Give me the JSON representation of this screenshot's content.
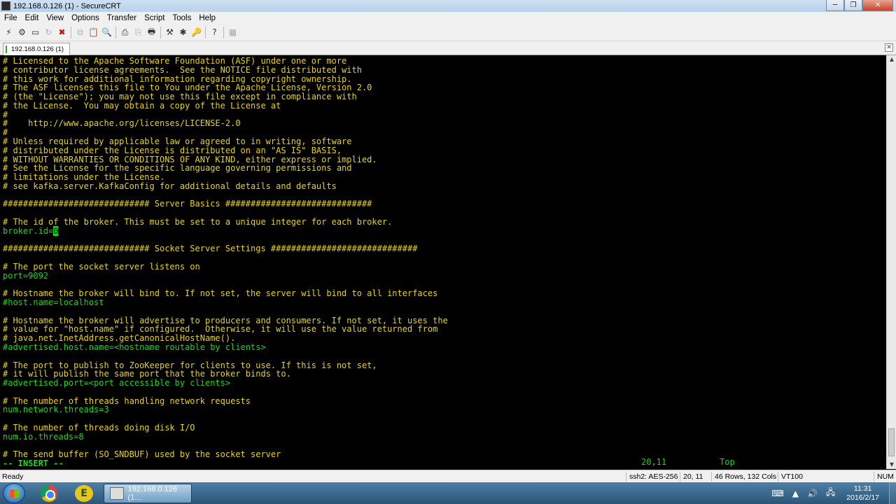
{
  "window": {
    "title": "192.168.0.126 (1) - SecureCRT"
  },
  "window_controls": {
    "minimize": "─",
    "restore": "❐",
    "close": "✕"
  },
  "menu": [
    "File",
    "Edit",
    "View",
    "Options",
    "Transfer",
    "Script",
    "Tools",
    "Help"
  ],
  "toolbar_icons": [
    "connect-icon",
    "quick-connect-icon",
    "connect-in-tab-icon",
    "reconnect-icon",
    "disconnect-icon",
    "copy-icon",
    "paste-icon",
    "find-icon",
    "print-icon",
    "print-selection-icon",
    "print-setup-icon",
    "session-options-icon",
    "global-options-icon",
    "keymap-icon",
    "help-icon",
    "sftp-icon"
  ],
  "tab": {
    "label": "192.168.0.126  (1)",
    "close": "✕"
  },
  "terminal": {
    "lines": [
      {
        "text": "# Licensed to the Apache Software Foundation (ASF) under one or more",
        "kind": "comment"
      },
      {
        "text": "# contributor license agreements.  See the NOTICE file distributed with",
        "kind": "comment"
      },
      {
        "text": "# this work for additional information regarding copyright ownership.",
        "kind": "comment"
      },
      {
        "text": "# The ASF licenses this file to You under the Apache License, Version 2.0",
        "kind": "comment"
      },
      {
        "text": "# (the \"License\"); you may not use this file except in compliance with",
        "kind": "comment"
      },
      {
        "text": "# the License.  You may obtain a copy of the License at",
        "kind": "comment"
      },
      {
        "text": "#",
        "kind": "comment"
      },
      {
        "text": "#    http://www.apache.org/licenses/LICENSE-2.0",
        "kind": "comment"
      },
      {
        "text": "#",
        "kind": "comment"
      },
      {
        "text": "# Unless required by applicable law or agreed to in writing, software",
        "kind": "comment"
      },
      {
        "text": "# distributed under the License is distributed on an \"AS IS\" BASIS,",
        "kind": "comment"
      },
      {
        "text": "# WITHOUT WARRANTIES OR CONDITIONS OF ANY KIND, either express or implied.",
        "kind": "comment"
      },
      {
        "text": "# See the License for the specific language governing permissions and",
        "kind": "comment"
      },
      {
        "text": "# limitations under the License.",
        "kind": "comment"
      },
      {
        "text": "# see kafka.server.KafkaConfig for additional details and defaults",
        "kind": "comment"
      },
      {
        "text": "",
        "kind": "blank"
      },
      {
        "text": "############################# Server Basics #############################",
        "kind": "comment"
      },
      {
        "text": "",
        "kind": "blank"
      },
      {
        "text": "# The id of the broker. This must be set to a unique integer for each broker.",
        "kind": "comment"
      },
      {
        "text": "broker.id=",
        "kind": "code",
        "cursor_char": "0"
      },
      {
        "text": "",
        "kind": "blank"
      },
      {
        "text": "############################# Socket Server Settings #############################",
        "kind": "comment"
      },
      {
        "text": "",
        "kind": "blank"
      },
      {
        "text": "# The port the socket server listens on",
        "kind": "comment"
      },
      {
        "text": "port=9092",
        "kind": "code"
      },
      {
        "text": "",
        "kind": "blank"
      },
      {
        "text": "# Hostname the broker will bind to. If not set, the server will bind to all interfaces",
        "kind": "comment"
      },
      {
        "text": "#host.name=localhost",
        "kind": "code"
      },
      {
        "text": "",
        "kind": "blank"
      },
      {
        "text": "# Hostname the broker will advertise to producers and consumers. If not set, it uses the",
        "kind": "comment"
      },
      {
        "text": "# value for \"host.name\" if configured.  Otherwise, it will use the value returned from",
        "kind": "comment"
      },
      {
        "text": "# java.net.InetAddress.getCanonicalHostName().",
        "kind": "comment"
      },
      {
        "text": "#advertised.host.name=<hostname routable by clients>",
        "kind": "code"
      },
      {
        "text": "",
        "kind": "blank"
      },
      {
        "text": "# The port to publish to ZooKeeper for clients to use. If this is not set,",
        "kind": "comment"
      },
      {
        "text": "# it will publish the same port that the broker binds to.",
        "kind": "comment"
      },
      {
        "text": "#advertised.port=<port accessible by clients>",
        "kind": "code"
      },
      {
        "text": "",
        "kind": "blank"
      },
      {
        "text": "# The number of threads handling network requests",
        "kind": "comment"
      },
      {
        "text": "num.network.threads=3",
        "kind": "code"
      },
      {
        "text": "",
        "kind": "blank"
      },
      {
        "text": "# The number of threads doing disk I/O",
        "kind": "comment"
      },
      {
        "text": "num.io.threads=8",
        "kind": "code"
      },
      {
        "text": "",
        "kind": "blank"
      },
      {
        "text": "# The send buffer (SO_SNDBUF) used by the socket server",
        "kind": "comment"
      }
    ],
    "mode_line": "-- INSERT --",
    "cursor_pos": "20,11",
    "scroll_pos": "Top"
  },
  "statusbar": {
    "ready": "Ready",
    "cipher": "ssh2: AES-256",
    "position": "20,  11",
    "size": "46 Rows, 132 Cols",
    "emulation": "VT100",
    "numlock": "NUM"
  },
  "taskbar": {
    "window_label": "192.168.0.126 (1...",
    "time": "11:31",
    "date": "2016/2/17"
  },
  "colors": {
    "terminal_comment": "#e8d21c",
    "terminal_code": "#17d817",
    "terminal_bg": "#000000"
  }
}
